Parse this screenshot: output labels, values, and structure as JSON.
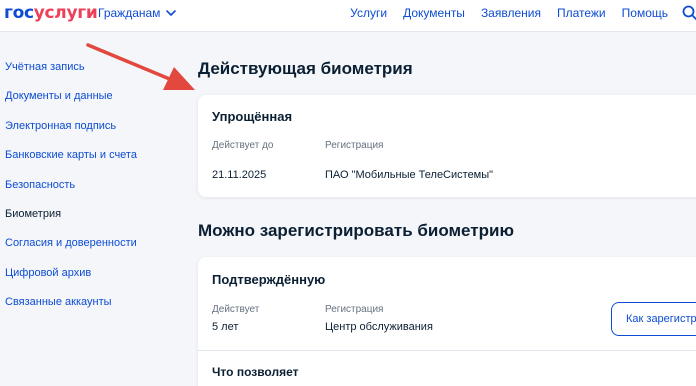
{
  "header": {
    "logo_part1": "гос",
    "logo_part2": "услуги",
    "role": "Гражданам",
    "nav": [
      "Услуги",
      "Документы",
      "Заявления",
      "Платежи",
      "Помощь"
    ]
  },
  "sidebar": {
    "items": [
      {
        "label": "Учётная запись"
      },
      {
        "label": "Документы и данные"
      },
      {
        "label": "Электронная подпись"
      },
      {
        "label": "Банковские карты и счета"
      },
      {
        "label": "Безопасность"
      },
      {
        "label": "Биометрия"
      },
      {
        "label": "Согласия и доверенности"
      },
      {
        "label": "Цифровой архив"
      },
      {
        "label": "Связанные аккаунты"
      }
    ],
    "active": "Биометрия"
  },
  "main": {
    "title": "Действующая биометрия",
    "current_card": {
      "title": "Упрощённая",
      "valid_until_label": "Действует до",
      "valid_until_value": "21.11.2025",
      "registration_label": "Регистрация",
      "registration_value": "ПАО \"Мобильные ТелеСистемы\""
    },
    "available_title": "Можно зарегистрировать биометрию",
    "available_card": {
      "title": "Подтверждённую",
      "validity_label": "Действует",
      "validity_value": "5 лет",
      "registration_label": "Регистрация",
      "registration_value": "Центр обслуживания",
      "button_label": "Как зарегистрировать",
      "more_title": "Что позволяет"
    }
  },
  "colors": {
    "accent": "#0d4cd3",
    "brand_red": "#ee3f58",
    "annotation_arrow": "#e2483d",
    "background": "#f4f6fa"
  },
  "icons": {
    "search": "search-icon",
    "chevron": "chevron-down-icon"
  }
}
